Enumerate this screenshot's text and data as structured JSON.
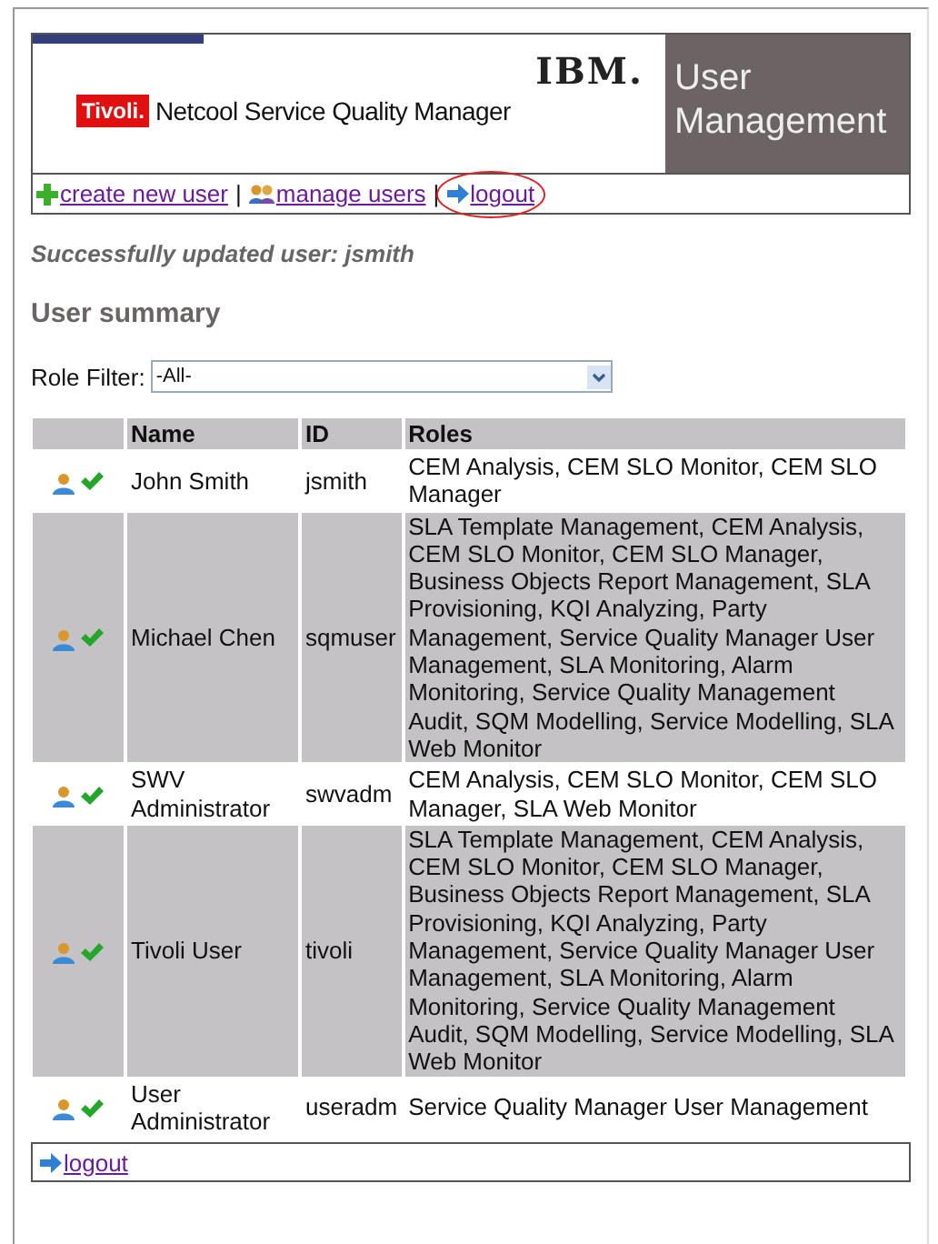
{
  "header": {
    "brand_badge": "Tivoli.",
    "product": "Netcool Service Quality Manager",
    "vendor": "IBM.",
    "title": "User Management"
  },
  "nav": [
    {
      "kind": "create",
      "label": "create new user",
      "highlighted": false
    },
    {
      "kind": "users",
      "label": "manage users",
      "highlighted": false
    },
    {
      "kind": "logout",
      "label": "logout",
      "highlighted": true
    }
  ],
  "nav_separator": "|",
  "message": "Successfully updated user: jsmith",
  "section_title": "User summary",
  "role_filter": {
    "label": "Role Filter:",
    "value": "-All-"
  },
  "table": {
    "columns": [
      "Name",
      "ID",
      "Roles"
    ],
    "rows": [
      {
        "name": "John Smith",
        "id": "jsmith",
        "roles": "CEM Analysis, CEM SLO Monitor, CEM SLO Manager",
        "active": true
      },
      {
        "name": "Michael Chen",
        "id": "sqmuser",
        "roles": "SLA Template Management, CEM Analysis, CEM SLO Monitor, CEM SLO Manager, Business Objects Report Management, SLA Provisioning, KQI Analyzing, Party Management, Service Quality Manager User Management, SLA Monitoring, Alarm Monitoring, Service Quality Management Audit, SQM Modelling, Service Modelling, SLA Web Monitor",
        "active": true
      },
      {
        "name": "SWV Administrator",
        "id": "swvadm",
        "roles": "CEM Analysis, CEM SLO Monitor, CEM SLO Manager, SLA Web Monitor",
        "active": true
      },
      {
        "name": "Tivoli User",
        "id": "tivoli",
        "roles": "SLA Template Management, CEM Analysis, CEM SLO Monitor, CEM SLO Manager, Business Objects Report Management, SLA Provisioning, KQI Analyzing, Party Management, Service Quality Manager User Management, SLA Monitoring, Alarm Monitoring, Service Quality Management Audit, SQM Modelling, Service Modelling, SLA Web Monitor",
        "active": true
      },
      {
        "name": "User Administrator",
        "id": "useradm",
        "roles": "Service Quality Manager User Management",
        "active": true
      }
    ]
  },
  "footer_nav": [
    {
      "kind": "logout",
      "label": "logout"
    }
  ]
}
